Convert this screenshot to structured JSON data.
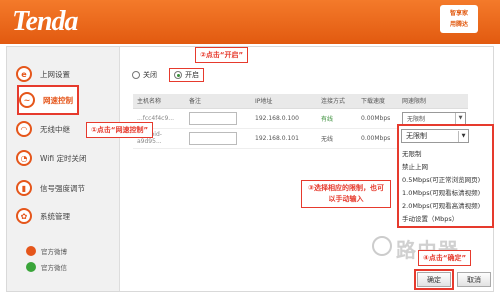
{
  "header": {
    "brand": "Tenda",
    "app_badge_line1": "智享家",
    "app_badge_line2": "用腾达"
  },
  "sidebar": {
    "items": [
      {
        "label": "上网设置",
        "icon": "globe-icon"
      },
      {
        "label": "网速控制",
        "icon": "speed-icon"
      },
      {
        "label": "无线中继",
        "icon": "relay-icon"
      },
      {
        "label": "Wifi 定时关闭",
        "icon": "wifi-icon"
      },
      {
        "label": "信号强度调节",
        "icon": "signal-icon"
      },
      {
        "label": "系统管理",
        "icon": "gear-icon"
      }
    ],
    "social": [
      {
        "label": "官方微博",
        "icon": "weibo-icon"
      },
      {
        "label": "官方微信",
        "icon": "wechat-icon"
      }
    ]
  },
  "radios": {
    "off_label": "关闭",
    "on_label": "开启"
  },
  "table": {
    "headers": [
      "主机名称",
      "备注",
      "IP地址",
      "连接方式",
      "下载速度",
      "网速限制"
    ],
    "rows": [
      {
        "host": "...fcc4f4c9...",
        "ip": "192.168.0.100",
        "conn": "有线",
        "speed": "0.00Mbps",
        "limit": "无限制"
      },
      {
        "host": "android-a9d95...",
        "ip": "192.168.0.101",
        "conn": "无线",
        "speed": "0.00Mbps",
        "limit": "无限制"
      }
    ]
  },
  "dropdown": {
    "selected": "无限制",
    "options": [
      "无限制",
      "禁止上网",
      "0.5Mbps(可正常浏览网页)",
      "1.0Mbps(可观看标清视频)",
      "2.0Mbps(可观看高清视频)",
      "手动设置（Mbps）"
    ]
  },
  "callouts": {
    "step1": "①点击“网速控制”",
    "step2": "②点击“开启”",
    "step3": "③选择相应的限制，也可以手动输入",
    "step4": "④点击“确定”"
  },
  "buttons": {
    "confirm": "确定",
    "cancel": "取消"
  },
  "watermark": "路由器"
}
